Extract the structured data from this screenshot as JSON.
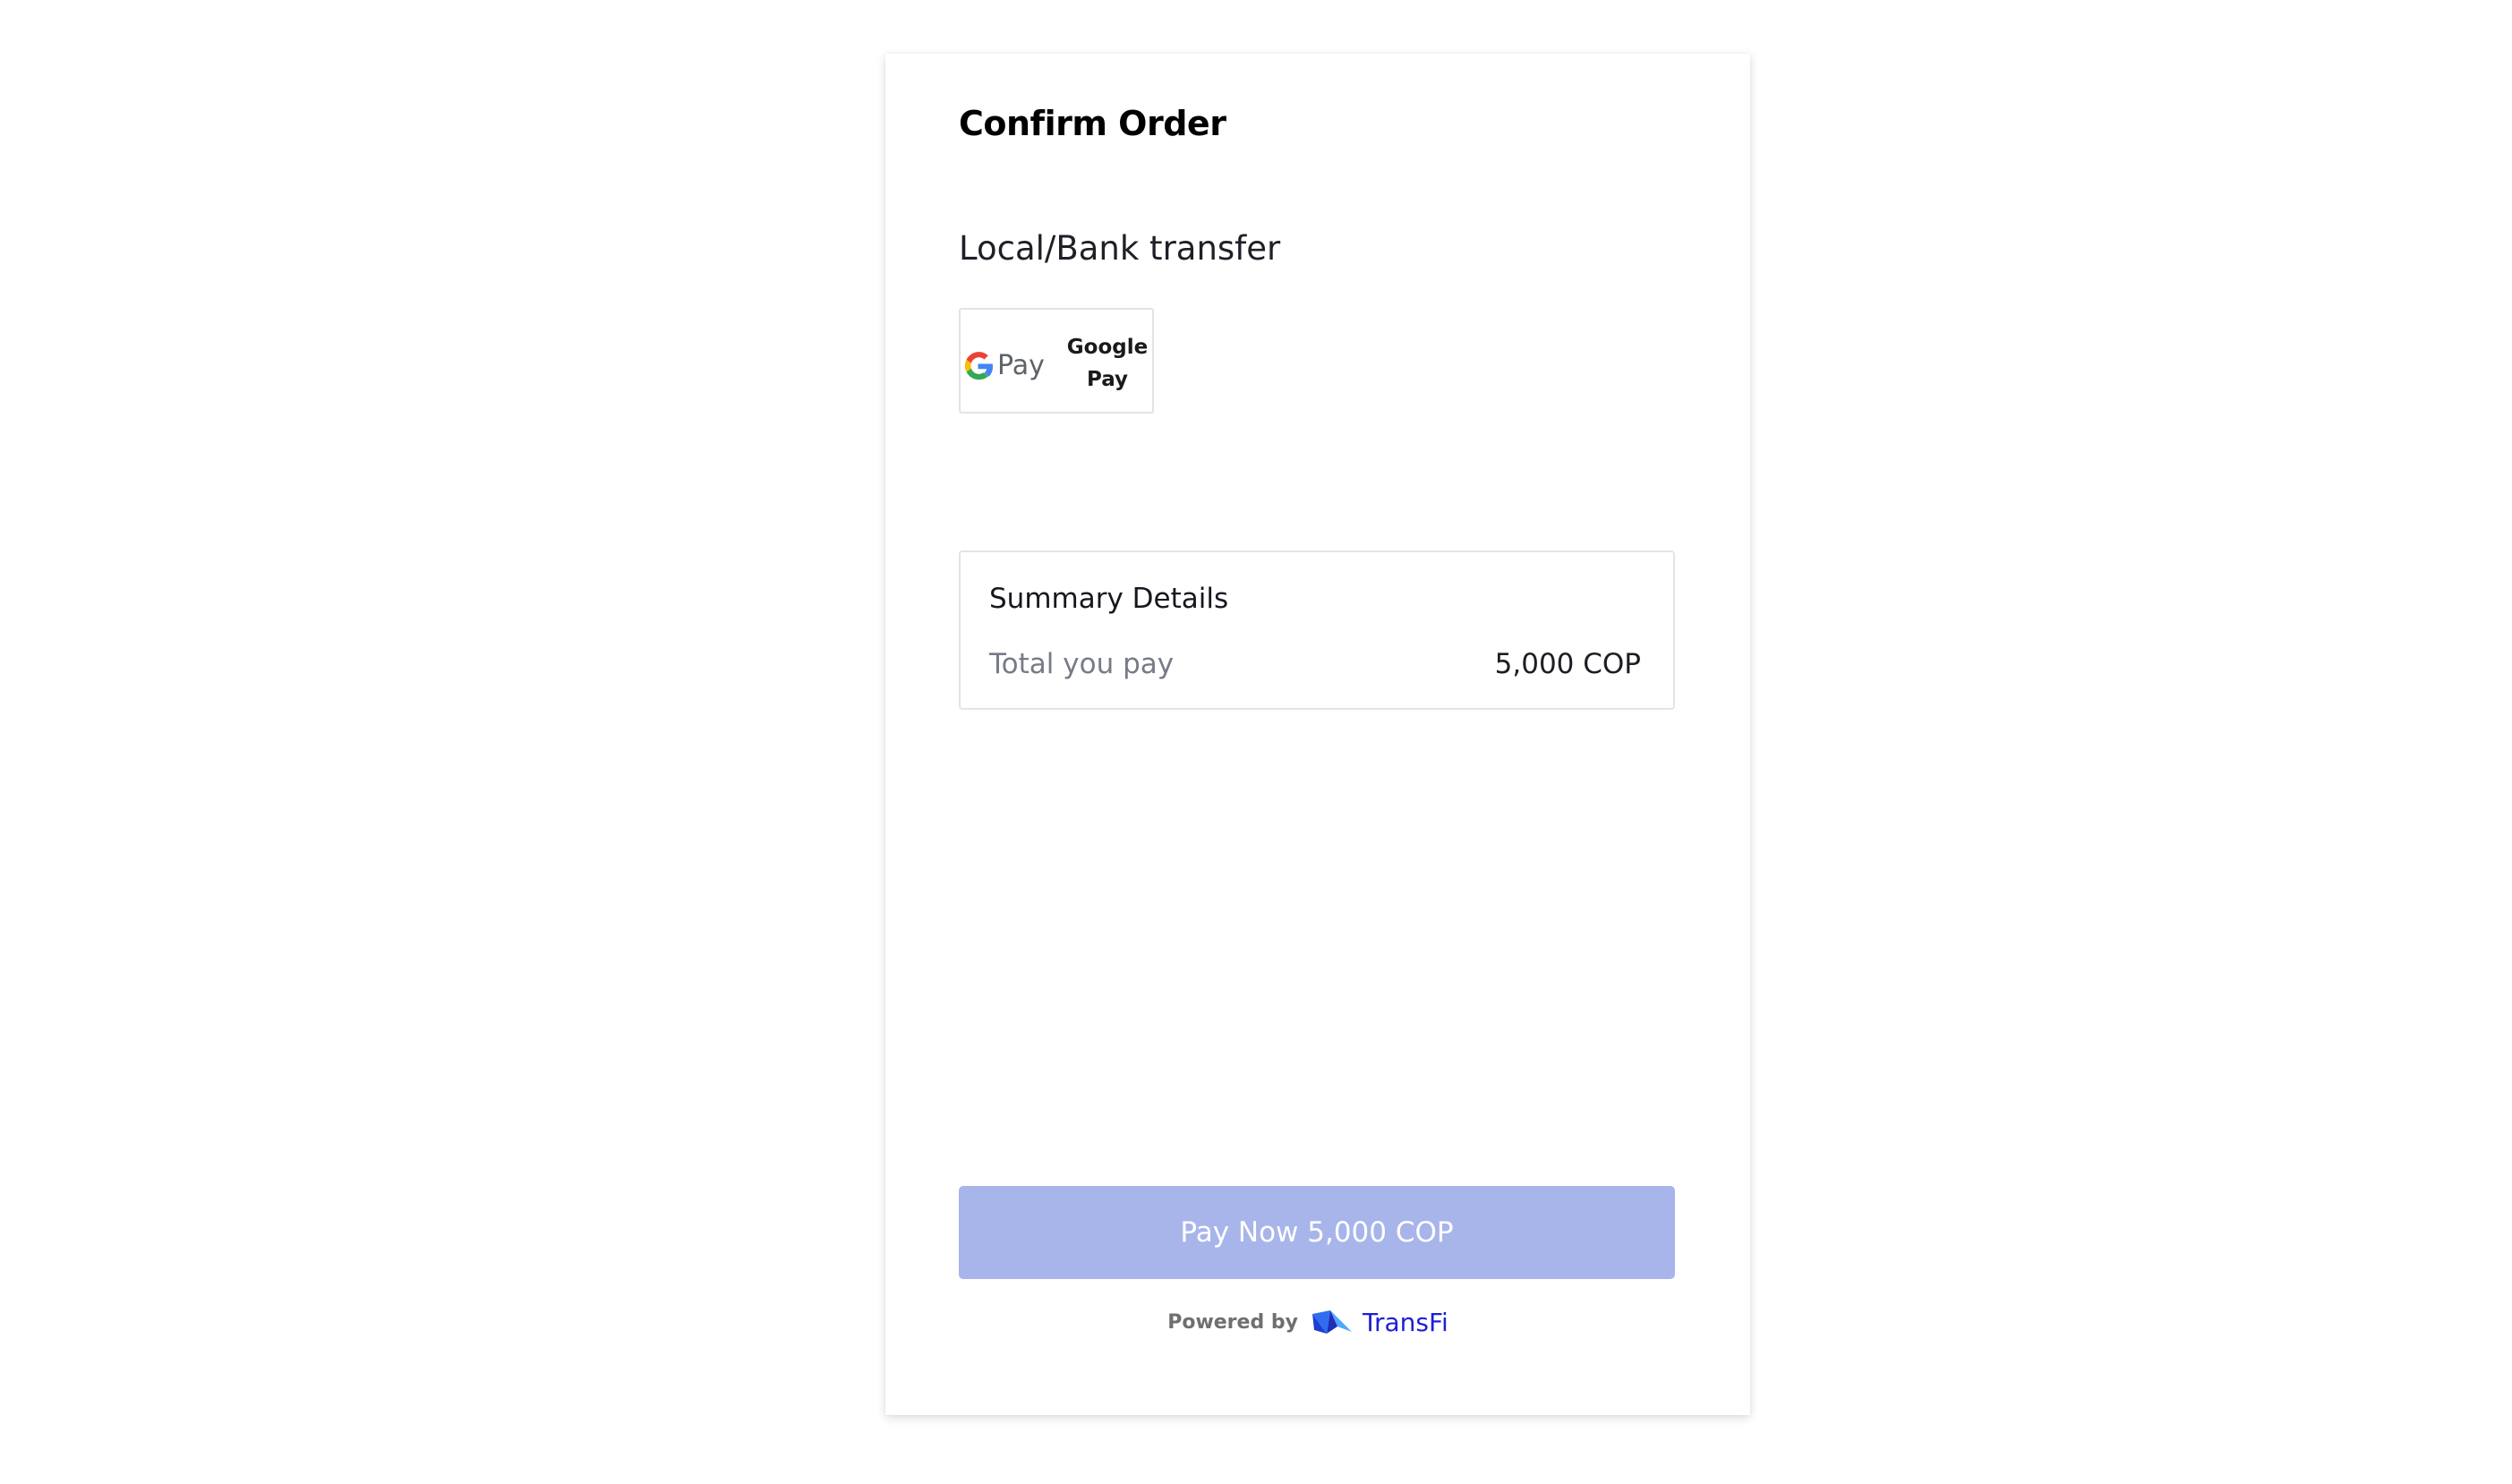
{
  "page": {
    "title": "Confirm Order"
  },
  "payment_method": {
    "section_heading": "Local/Bank transfer",
    "options": [
      {
        "logo_text": "G Pay",
        "icon": "google-pay-logo",
        "label": "Google\nPay"
      }
    ]
  },
  "summary": {
    "title": "Summary Details",
    "rows": [
      {
        "label": "Total you pay",
        "value": "5,000 COP"
      }
    ]
  },
  "actions": {
    "pay_button_label": "Pay Now 5,000 COP",
    "pay_button_enabled": false
  },
  "footer": {
    "powered_by_label": "Powered by",
    "brand_name": "TransFi",
    "brand_icon": "transfi-logo"
  },
  "colors": {
    "pay_button_bg": "#a8b5ea",
    "brand_text": "#1b1fd6",
    "muted_text": "#777b86"
  }
}
